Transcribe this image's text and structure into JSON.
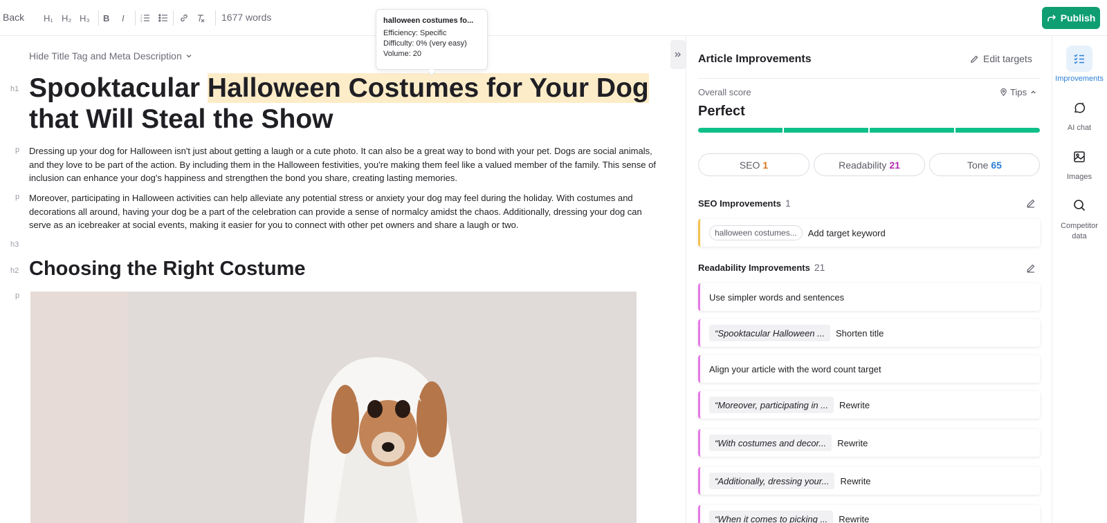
{
  "toolbar": {
    "back_label": "Back",
    "h1_label": "H₁",
    "h2_label": "H₂",
    "h3_label": "H₃",
    "bold_label": "B",
    "italic_label": "I",
    "word_count": "1677 words",
    "publish_label": "Publish",
    "publish_color": "#0e9e72"
  },
  "tooltip": {
    "title": "halloween costumes fo...",
    "efficiency": "Efficiency: Specific",
    "difficulty": "Difficulty: 0% (very easy)",
    "volume": "Volume: 20"
  },
  "editor": {
    "hide_meta_label": "Hide Title Tag and Meta Description",
    "gutter": {
      "h1": "h1",
      "p1": "p",
      "p2": "p",
      "h3": "h3",
      "h2": "h2",
      "p3": "p"
    },
    "title_prefix": "Spooktacular ",
    "title_highlight": "Halloween Costumes for Your Dog",
    "title_suffix": "that Will Steal the Show",
    "highlight_color": "#fdecc8",
    "paragraph_1": "Dressing up your dog for Halloween isn't just about getting a laugh or a cute photo. It can also be a great way to bond with your pet. Dogs are social animals, and they love to be part of the action. By including them in the Halloween festivities, you're making them feel like a valued member of the family. This sense of inclusion can enhance your dog's happiness and strengthen the bond you share, creating lasting memories.",
    "paragraph_2": "Moreover, participating in Halloween activities can help alleviate any potential stress or anxiety your dog may feel during the holiday. With costumes and decorations all around, having your dog be a part of the celebration can provide a sense of normalcy amidst the chaos. Additionally, dressing your dog can serve as an icebreaker at social events, making it easier for you to connect with other pet owners and share a laugh or two.",
    "heading_2": "Choosing the Right Costume"
  },
  "panel": {
    "title": "Article Improvements",
    "edit_targets_label": "Edit targets",
    "overall_label": "Overall score",
    "tips_label": "Tips",
    "overall_value": "Perfect",
    "score_color": "#0fbf8a",
    "tabs": [
      {
        "label": "SEO",
        "count": "1",
        "color": "#d9731a"
      },
      {
        "label": "Readability",
        "count": "21",
        "color": "#b32bb3"
      },
      {
        "label": "Tone",
        "count": "65",
        "color": "#2b7fd6"
      }
    ],
    "seo_section": {
      "title": "SEO Improvements",
      "count": "1"
    },
    "seo_items": [
      {
        "chip": "halloween costumes...",
        "text": "Add target keyword"
      }
    ],
    "readability_section": {
      "title": "Readability Improvements",
      "count": "21"
    },
    "readability_items": [
      {
        "quote": "",
        "text": "Use simpler words and sentences"
      },
      {
        "quote": "“Spooktacular Halloween ...",
        "text": "Shorten title"
      },
      {
        "quote": "",
        "text": "Align your article with the word count target"
      },
      {
        "quote": "“Moreover, participating in ...",
        "text": "Rewrite"
      },
      {
        "quote": "“With costumes and decor...",
        "text": "Rewrite"
      },
      {
        "quote": "“Additionally, dressing your...",
        "text": "Rewrite"
      },
      {
        "quote": "“When it comes to picking ...",
        "text": "Rewrite"
      }
    ]
  },
  "rail": {
    "items": [
      {
        "label": "Improvements",
        "icon": "checklist-icon"
      },
      {
        "label": "AI chat",
        "icon": "ai-chat-icon"
      },
      {
        "label": "Images",
        "icon": "image-icon"
      },
      {
        "label": "Competitor data",
        "icon": "search-icon"
      }
    ],
    "active_color": "#2b7fd6"
  }
}
